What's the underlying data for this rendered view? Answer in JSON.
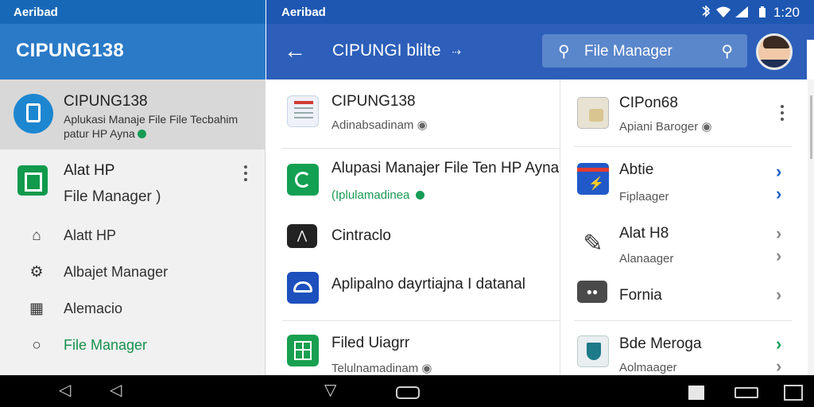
{
  "left_status": {
    "carrier": "Aeribad"
  },
  "left_appbar": {
    "title": "CIPUNG138"
  },
  "left_card": {
    "name": "CIPUNG138",
    "desc_line1": "Aplukasi Manaje File File Tecbahim",
    "desc_line2": "patur HP Ayna"
  },
  "alat_item": {
    "title": "Alat HP",
    "subtitle": "File Manager )"
  },
  "left_nav": [
    {
      "label": "Alatt HP",
      "icon": "home-icon"
    },
    {
      "label": "Albajet Manager",
      "icon": "gear-icon"
    },
    {
      "label": "Alemacio",
      "icon": "grid-icon"
    },
    {
      "label": "File Manager",
      "icon": "circle-icon",
      "active": true
    }
  ],
  "right_status": {
    "carrier": "Aeribad",
    "time": "1:20"
  },
  "right_appbar": {
    "title": "CIPUNGI blilte",
    "search_placeholder": "File Manager"
  },
  "mid_list": [
    {
      "title": "CIPUNG138",
      "subtitle": "Adinabsadinam",
      "icon": "document-icon"
    },
    {
      "title": "Alupasi Manajer File Ten HP Ayna",
      "subtitle": "(Iplulamadinea",
      "icon": "refresh-icon",
      "green": true
    },
    {
      "title": "Cintraclo",
      "subtitle": "",
      "icon": "tool-icon"
    },
    {
      "title": "Aplipalno dayrtiajna I datanal",
      "subtitle": "",
      "icon": "cloud-icon"
    },
    {
      "title": "Filed Uiagrr",
      "subtitle": "Telulnamadinam",
      "icon": "spreadsheet-icon"
    }
  ],
  "right_list": [
    {
      "title": "CIPon68",
      "subtitle": "Apiani Baroger",
      "icon": "files-icon"
    },
    {
      "title": "Abtie",
      "subtitle": "Fiplaager",
      "icon": "bolt-icon"
    },
    {
      "title": "Alat H8",
      "subtitle": "Alanaager",
      "icon": "wrench-icon"
    },
    {
      "title": "Fornia",
      "subtitle": "",
      "icon": "binoculars-icon"
    },
    {
      "title": "Bde Meroga",
      "subtitle": "Aolmaager",
      "icon": "shield-icon"
    }
  ],
  "colors": {
    "left_status": "#1769b8",
    "left_appbar": "#2a7ac7",
    "right_appbar": "#2d5fba",
    "accent_green": "#18904e"
  }
}
